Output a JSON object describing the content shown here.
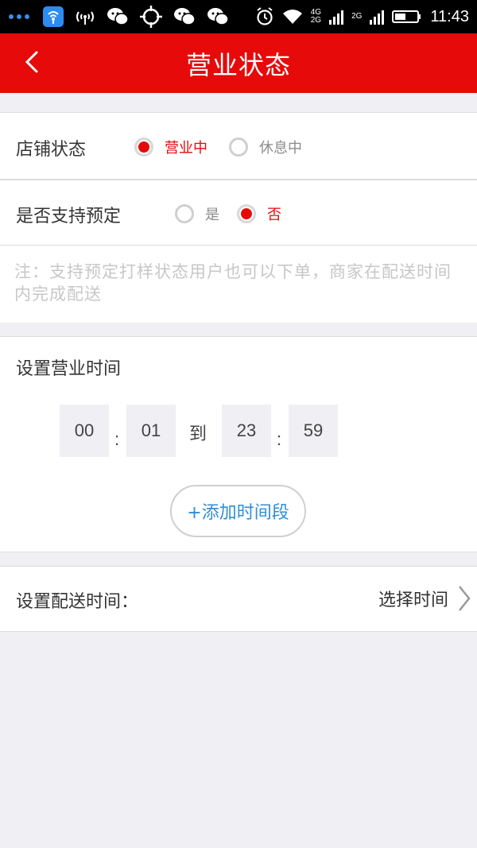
{
  "status_bar": {
    "time": "11:43",
    "network_top": "4G",
    "network_bottom": "2G",
    "network_secondary": "2G",
    "icons": [
      "more-dots-icon",
      "wifi-hotspot-icon",
      "signal-icon",
      "wechat-icon",
      "crosshair-icon",
      "wechat-icon",
      "wechat-icon",
      "alarm-icon",
      "wifi-icon",
      "signal-bars-icon",
      "battery-icon"
    ]
  },
  "header": {
    "title": "营业状态",
    "back_icon": "chevron-left-icon"
  },
  "store_status": {
    "label": "店铺状态",
    "options": [
      {
        "label": "营业中",
        "selected": true
      },
      {
        "label": "休息中",
        "selected": false
      }
    ]
  },
  "reservation": {
    "label": "是否支持预定",
    "options": [
      {
        "label": "是",
        "selected": false
      },
      {
        "label": "否",
        "selected": true
      }
    ]
  },
  "note": "注：支持预定打样状态用户也可以下单，商家在配送时间内完成配送",
  "business_hours": {
    "title": "设置营业时间",
    "start_hour": "00",
    "start_minute": "01",
    "to_label": "到",
    "end_hour": "23",
    "end_minute": "59",
    "colon": ":",
    "add_button": "+添加时间段"
  },
  "delivery": {
    "label": "设置配送时间：",
    "value": "选择时间",
    "icon": "chevron-right-icon"
  },
  "colors": {
    "accent": "#e60a0a",
    "link": "#2f8fd6",
    "background": "#efeff4"
  }
}
